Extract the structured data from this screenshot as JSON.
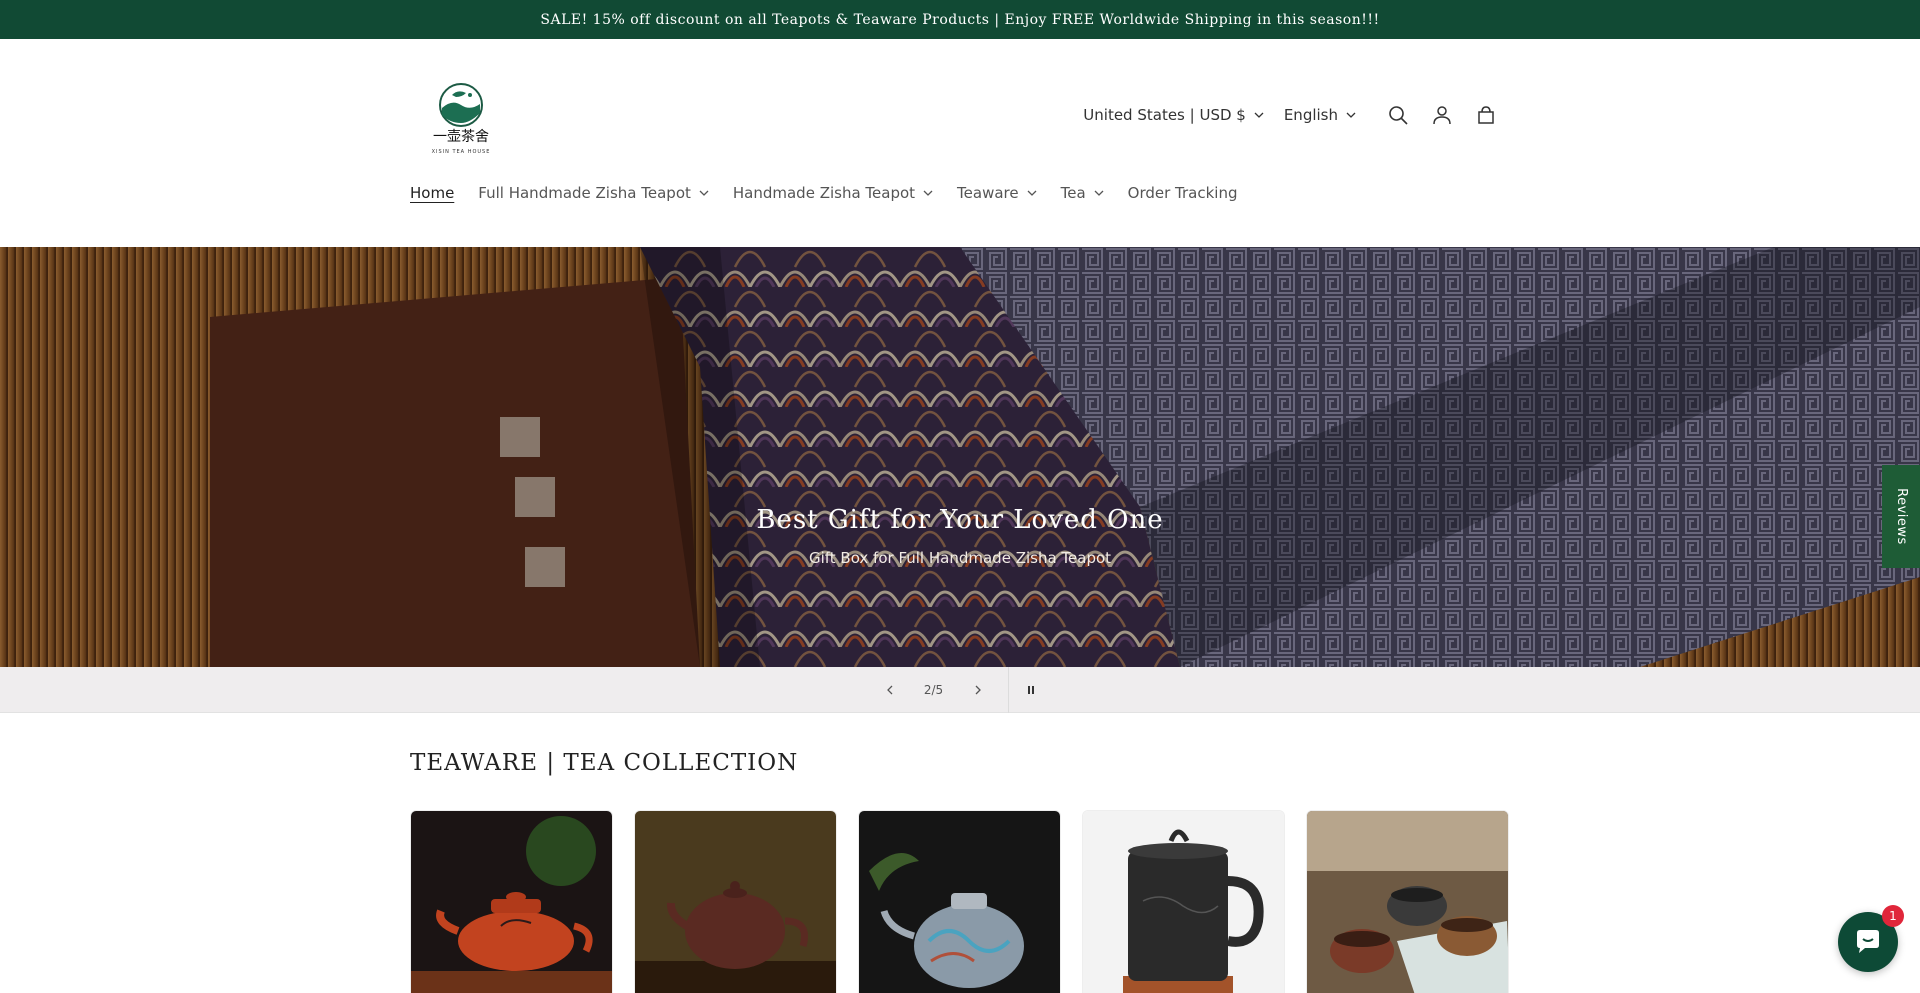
{
  "announcement": {
    "text": "SALE! 15% off discount on all Teapots & Teaware Products | Enjoy FREE Worldwide Shipping in this season!!!"
  },
  "header": {
    "logo_text": "一壶茶舍",
    "logo_subtext": "XISIN TEA HOUSE",
    "currency_label": "United States | USD $",
    "language_label": "English",
    "icons": [
      "search-icon",
      "account-icon",
      "cart-icon"
    ]
  },
  "nav": {
    "items": [
      {
        "label": "Home",
        "active": true,
        "dropdown": false
      },
      {
        "label": "Full Handmade Zisha Teapot",
        "dropdown": true
      },
      {
        "label": "Handmade Zisha Teapot",
        "dropdown": true
      },
      {
        "label": "Teaware",
        "dropdown": true
      },
      {
        "label": "Tea",
        "dropdown": true
      },
      {
        "label": "Order Tracking",
        "dropdown": false
      }
    ]
  },
  "hero": {
    "title": "Best Gift for Your Loved One",
    "subtitle": "Gift Box for Full Handmade Zisha Teapot",
    "slide_counter": "2/5",
    "current_slide": 2,
    "total_slides": 5
  },
  "reviews_tab": {
    "label": "Reviews"
  },
  "collection": {
    "title": "TEAWARE | TEA COLLECTION",
    "cards": [
      {
        "name": "red-zisha-teapot"
      },
      {
        "name": "brown-zisha-teapot"
      },
      {
        "name": "silver-teapot"
      },
      {
        "name": "black-mug"
      },
      {
        "name": "tea-cups"
      }
    ]
  },
  "chat": {
    "badge_count": "1"
  },
  "colors": {
    "brand_green": "#114a34",
    "badge_red": "#e0263a",
    "reviews_green": "#1e5c36"
  }
}
